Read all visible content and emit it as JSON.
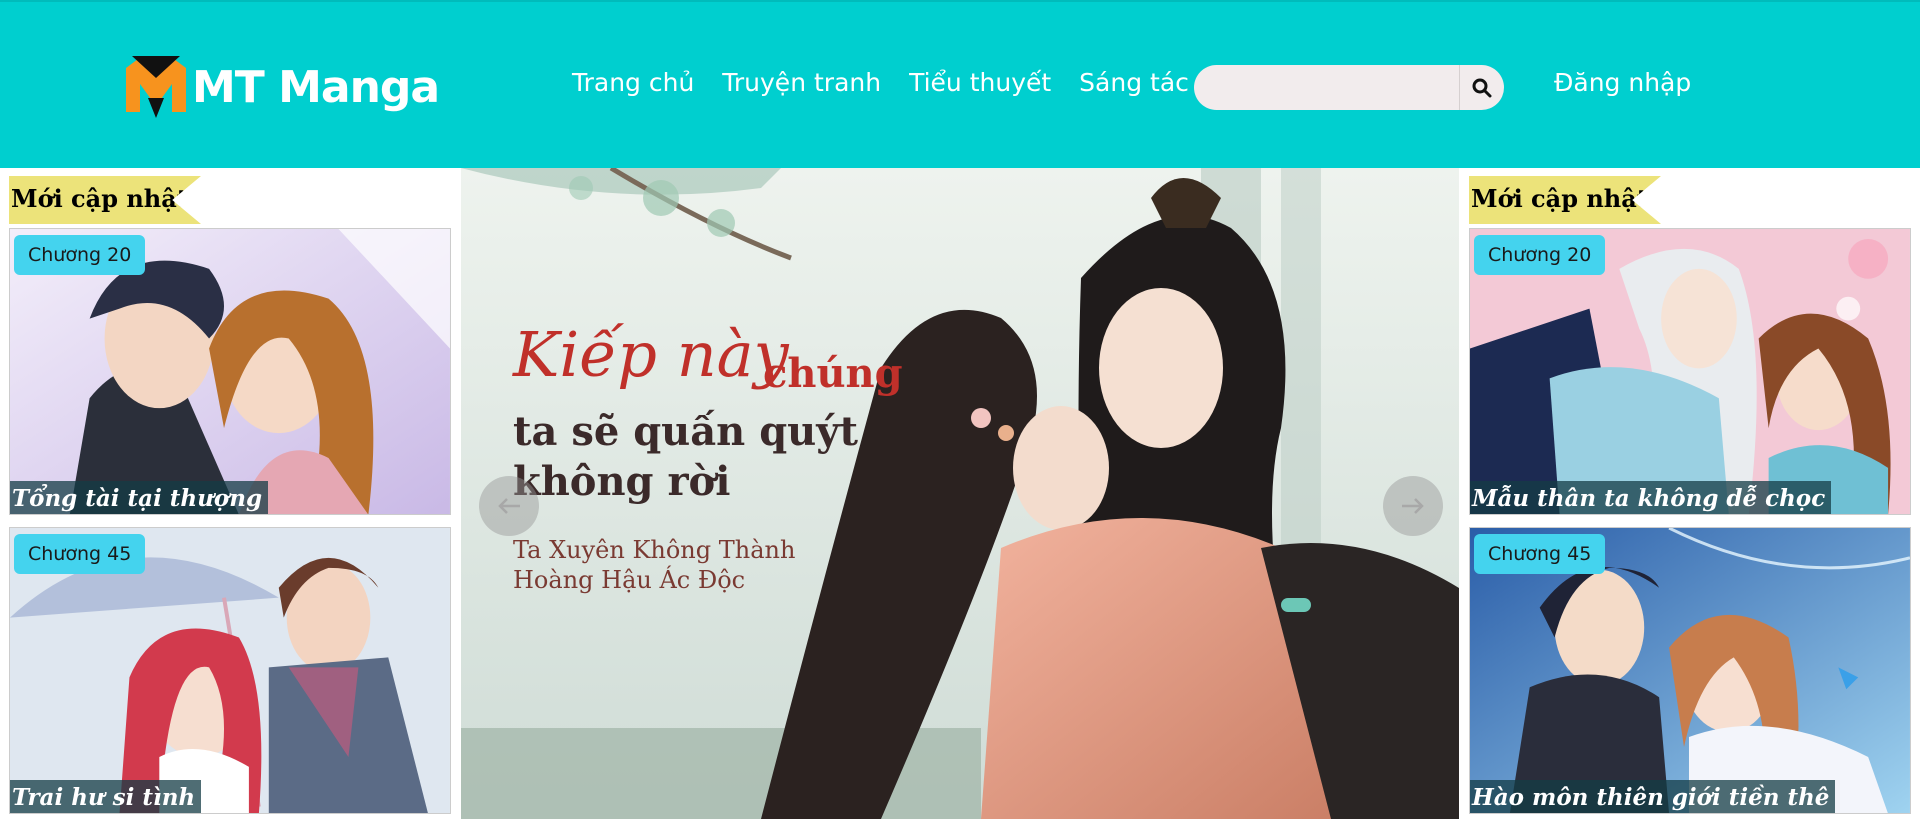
{
  "header": {
    "logo_text": "MT Manga",
    "nav": [
      "Trang chủ",
      "Truyện tranh",
      "Tiểu thuyết",
      "Sáng tác"
    ],
    "search_placeholder": "",
    "login_label": "Đăng nhập",
    "colors": {
      "header_bg": "#00cfcf",
      "logo_orange": "#f7931e"
    }
  },
  "left_column": {
    "section_title": "Mới cập nhật",
    "cards": [
      {
        "chapter": "Chương 20",
        "title": "Tổng tài tại thượng"
      },
      {
        "chapter": "Chương 45",
        "title": "Trai hư si tình"
      }
    ]
  },
  "right_column": {
    "section_title": "Mới cập nhật",
    "cards": [
      {
        "chapter": "Chương 20",
        "title": "Mẫu thân ta không dễ chọc"
      },
      {
        "chapter": "Chương 45",
        "title": "Hào môn thiên giới tiền thê"
      }
    ]
  },
  "slider": {
    "title_part1": "Kiếp này",
    "title_part1b": "chúng",
    "title_part2": "ta sẽ quấn quýt",
    "title_part3": "không rời",
    "subtitle_line1": "Ta Xuyên Không Thành",
    "subtitle_line2": "Hoàng Hậu Ác Độc"
  }
}
